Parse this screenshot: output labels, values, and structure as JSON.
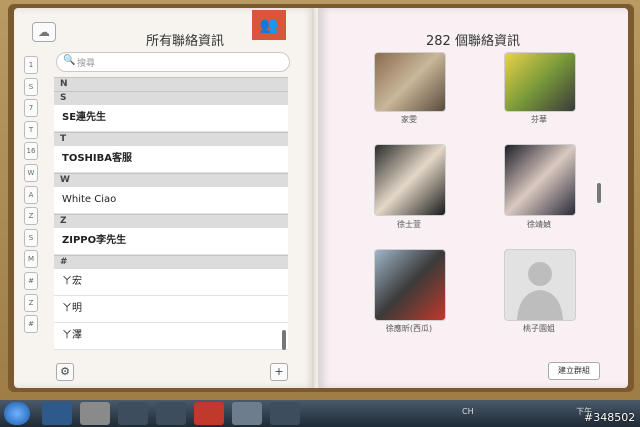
{
  "left_page": {
    "title": "所有聯絡資訊",
    "search_placeholder": "搜尋",
    "index_tabs": [
      "1",
      "S",
      "7",
      "T",
      "16",
      "W",
      "A",
      "Z",
      "S",
      "M",
      "#",
      "Z",
      "#"
    ],
    "sections": [
      {
        "header": "N",
        "rows": []
      },
      {
        "header": "S",
        "rows": [
          "SE連先生"
        ]
      },
      {
        "header": "T",
        "rows": [
          "TOSHIBA客服"
        ]
      },
      {
        "header": "W",
        "rows": [
          "White Ciao"
        ]
      },
      {
        "header": "Z",
        "rows": [
          "ZIPPO李先生"
        ]
      },
      {
        "header": "#",
        "rows": [
          "ㄚ宏",
          "ㄚ明",
          "ㄚ澤"
        ]
      }
    ],
    "gear_label": "⚙",
    "add_label": "+"
  },
  "right_page": {
    "title": "282 個聯絡資訊",
    "contacts": [
      {
        "name": "家雯"
      },
      {
        "name": "芬華"
      },
      {
        "name": "徐士萱"
      },
      {
        "name": "徐靖媜"
      },
      {
        "name": "徐應昕(西瓜)"
      },
      {
        "name": "桃子園姐"
      }
    ],
    "group_button": "建立群組"
  },
  "taskbar": {
    "tray_text": "CH",
    "clock": "下午"
  },
  "watermark": "#348502",
  "colors": {
    "accent": "#d9553b",
    "page_left": "#f7f4ef",
    "page_right": "#f8f0f2",
    "leather": "#7d5a2e"
  }
}
